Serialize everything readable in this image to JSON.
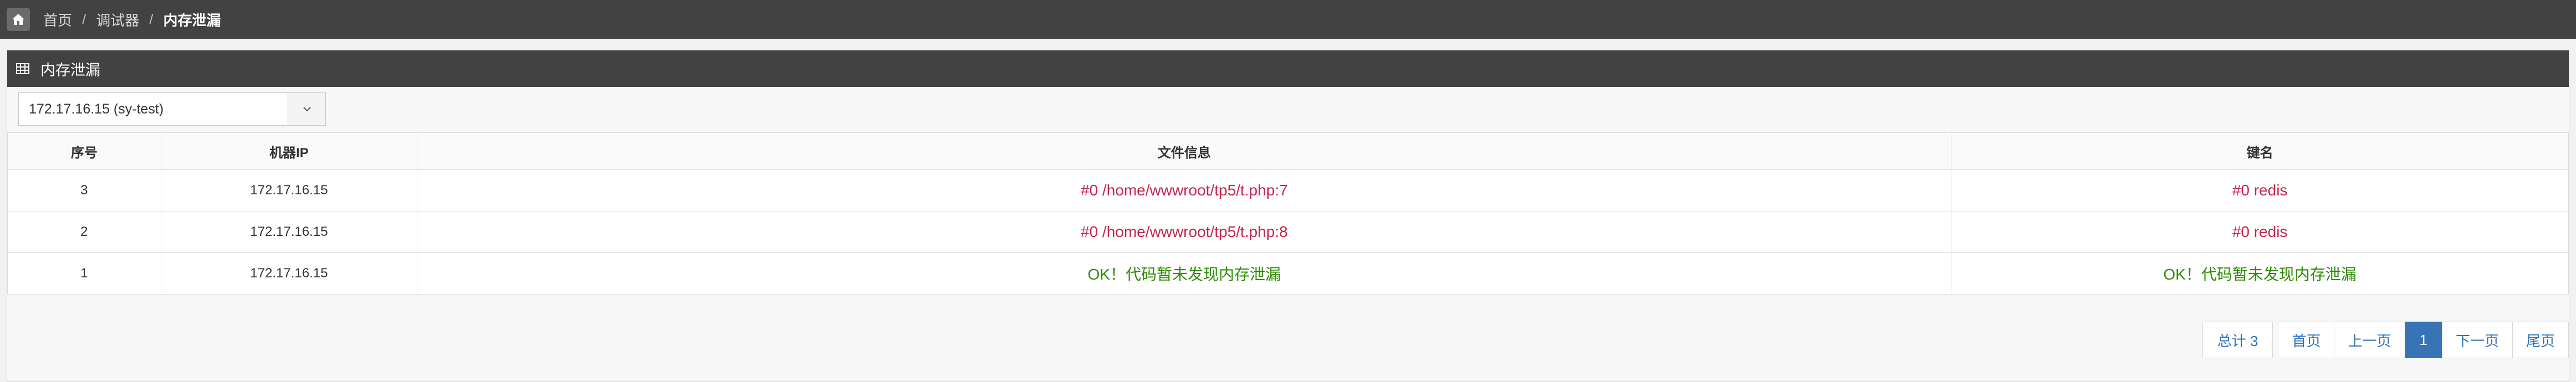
{
  "breadcrumb": {
    "items": [
      "首页",
      "调试器",
      "内存泄漏"
    ],
    "separator": "/"
  },
  "panel": {
    "title": "内存泄漏"
  },
  "server_select": {
    "value": "172.17.16.15 (sy-test)"
  },
  "table": {
    "headers": [
      "序号",
      "机器IP",
      "文件信息",
      "键名"
    ],
    "rows": [
      {
        "id": "3",
        "ip": "172.17.16.15",
        "file": "#0 /home/wwwroot/tp5/t.php:7",
        "key": "#0 redis",
        "status": "leak"
      },
      {
        "id": "2",
        "ip": "172.17.16.15",
        "file": "#0 /home/wwwroot/tp5/t.php:8",
        "key": "#0 redis",
        "status": "leak"
      },
      {
        "id": "1",
        "ip": "172.17.16.15",
        "file": "OK！代码暂未发现内存泄漏",
        "key": "OK！代码暂未发现内存泄漏",
        "status": "ok"
      }
    ]
  },
  "pagination": {
    "total": "总计 3",
    "first": "首页",
    "prev": "上一页",
    "current": "1",
    "next": "下一页",
    "last": "尾页"
  },
  "colors": {
    "leak": "#c7254e",
    "ok": "#2e8b00",
    "accent": "#3874b5",
    "topbar": "#424242"
  },
  "icons": [
    "home-icon",
    "table-grid-icon",
    "chevron-down-icon"
  ]
}
